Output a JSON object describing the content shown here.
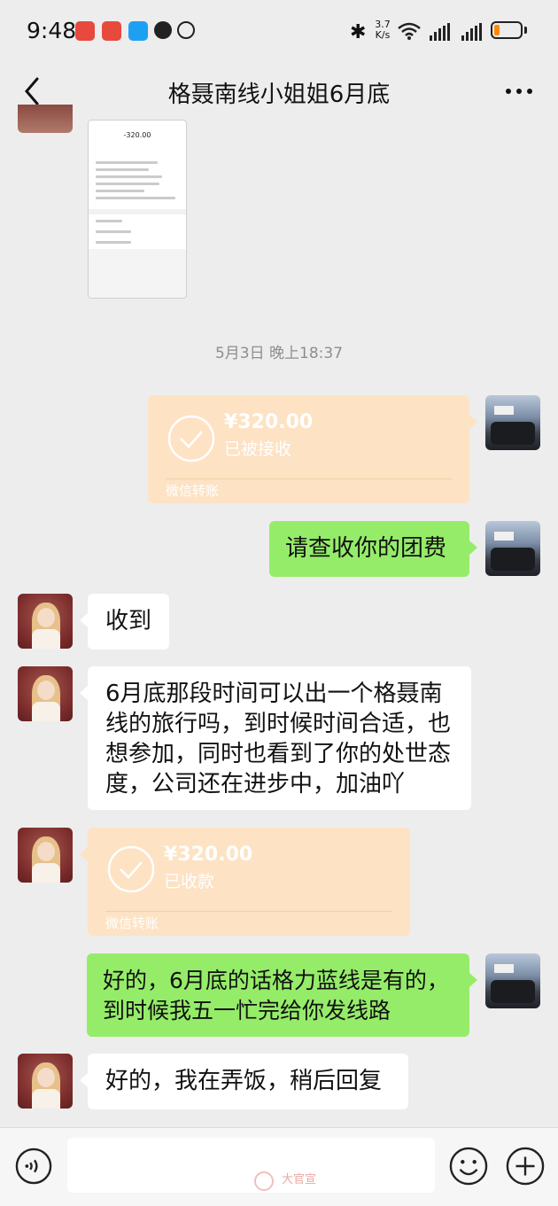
{
  "status_bar": {
    "time": "9:48",
    "speed_top": "3.7",
    "speed_bottom": "K/s",
    "icons": [
      "missed-call-icon",
      "notification-icon",
      "message-icon",
      "qq-icon",
      "alarm-icon",
      "bluetooth-icon",
      "wifi-icon",
      "signal-icon",
      "signal-icon",
      "battery-icon"
    ],
    "battery_level_fraction": 0.2
  },
  "header": {
    "title": "格聂南线小姐姐6月底",
    "back_icon": "chevron-left-icon",
    "more_icon": "more-dots-icon"
  },
  "receipt_image": {
    "amount": "-320.00"
  },
  "timestamp": "5月3日 晚上18:37",
  "messages": [
    {
      "side": "right",
      "type": "transfer",
      "amount": "¥320.00",
      "status": "已被接收",
      "footer": "微信转账"
    },
    {
      "side": "right",
      "type": "text",
      "text": "请查收你的团费"
    },
    {
      "side": "left",
      "type": "text",
      "text": "收到"
    },
    {
      "side": "left",
      "type": "text",
      "lines": [
        "6月底那段时间可以出一个格聂南",
        "线的旅行吗，到时候时间合适，也",
        "想参加，同时也看到了你的处世态",
        "度，公司还在进步中，加油吖"
      ]
    },
    {
      "side": "left",
      "type": "transfer",
      "amount": "¥320.00",
      "status": "已收款",
      "footer": "微信转账"
    },
    {
      "side": "right",
      "type": "text",
      "lines": [
        "好的，6月底的话格力蓝线是有的，",
        "到时候我五一忙完给你发线路"
      ]
    },
    {
      "side": "left",
      "type": "text",
      "text": "好的，我在弄饭，稍后回复"
    }
  ],
  "bottom_bar": {
    "voice_icon": "voice-input-icon",
    "emoji_icon": "emoji-icon",
    "plus_icon": "plus-icon",
    "watermark": "大官宣"
  },
  "colors": {
    "background": "#ededed",
    "green_bubble": "#95ec69",
    "transfer_bubble": "#fde2c4"
  }
}
